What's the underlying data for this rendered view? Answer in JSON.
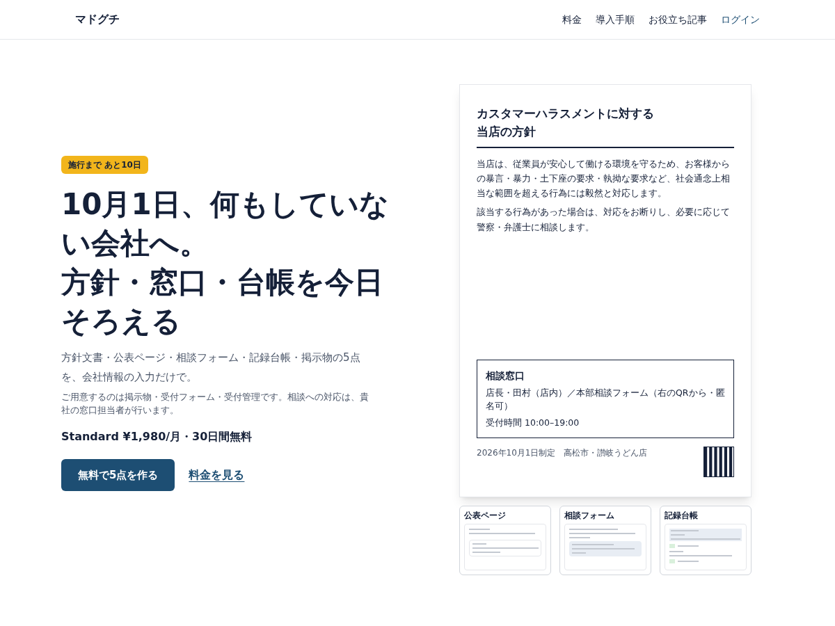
{
  "header": {
    "logo": "マドグチ",
    "nav": [
      {
        "label": "料金",
        "kind": "plain"
      },
      {
        "label": "導入手順",
        "kind": "plain"
      },
      {
        "label": "お役立ち記事",
        "kind": "plain"
      },
      {
        "label": "ログイン",
        "kind": "accent"
      }
    ]
  },
  "hero": {
    "badge": "施行まで あと10日",
    "title_lines": [
      "10月1日、何もしていない会社へ。",
      "方針・窓口・台帳を今日そろえる"
    ],
    "lead": "方針文書・公表ページ・相談フォーム・記録台帳・掲示物の5点を、会社情報の入力だけで。",
    "note": "ご用意するのは掲示物・受付フォーム・受付管理です。相談への対応は、貴社の窓口担当者が行います。",
    "price": "Standard ¥1,980/月・30日間無料",
    "cta": "無料で5点を作る",
    "link": "料金を見る"
  },
  "poster": {
    "title_lines": [
      "カスタマーハラスメントに対する",
      "当店の方針"
    ],
    "paragraphs": [
      "当店は、従業員が安心して働ける環境を守るため、お客様からの暴言・暴力・土下座の要求・執拗な要求など、社会通念上相当な範囲を超える行為には毅然と対応します。",
      "該当する行為があった場合は、対応をお断りし、必要に応じて警察・弁護士に相談します。"
    ],
    "contact": {
      "title": "相談窓口",
      "lines": [
        "店長・田村（店内）／本部相談フォーム（右のQRから・匿名可）",
        "受付時間 10:00–19:00"
      ]
    },
    "footer": "2026年10月1日制定　高松市・讃岐うどん店"
  },
  "thumbnails": [
    {
      "label": "公表ページ",
      "kind": "page"
    },
    {
      "label": "相談フォーム",
      "kind": "form"
    },
    {
      "label": "記録台帳",
      "kind": "ledger"
    }
  ]
}
